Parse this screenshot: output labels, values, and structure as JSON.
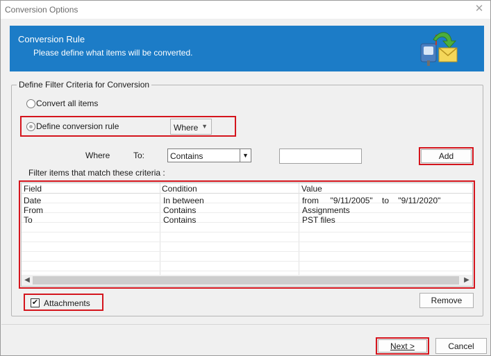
{
  "window": {
    "title": "Conversion Options"
  },
  "banner": {
    "title": "Conversion Rule",
    "subtitle": "Please define what items will be converted.",
    "icon": "mailbox-convert-icon"
  },
  "group": {
    "legend": "Define Filter Criteria for Conversion"
  },
  "options": {
    "convert_all_label": "Convert all items",
    "define_rule_label": "Define conversion rule",
    "selected": "define_rule",
    "rule_combo_value": "Where"
  },
  "criteria": {
    "where_label": "Where",
    "to_label": "To:",
    "condition_value": "Contains",
    "value_input": "",
    "add_label": "Add"
  },
  "filter": {
    "caption": "Filter items that match these criteria :",
    "columns": [
      "Field",
      "Condition",
      "Value"
    ],
    "rows": [
      [
        "Date",
        "In between",
        "from     \"9/11/2005\"    to    \"9/11/2020\""
      ],
      [
        "From",
        "Contains",
        "Assignments"
      ],
      [
        "To",
        "Contains",
        "PST files"
      ]
    ]
  },
  "attachments": {
    "label": "Attachments",
    "checked": true
  },
  "buttons": {
    "remove_label": "Remove",
    "next_label": "Next >",
    "cancel_label": "Cancel"
  },
  "colors": {
    "banner": "#1c7cc7",
    "highlight": "#d4141c"
  }
}
